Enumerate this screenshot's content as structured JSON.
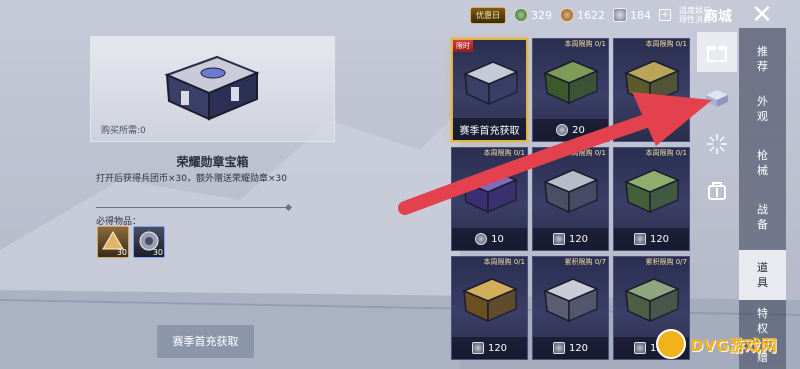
{
  "topbar": {
    "vip_label": "优惠日",
    "currencies": [
      {
        "icon": "green-coin-icon",
        "value": "329"
      },
      {
        "icon": "bronze-coin-icon",
        "value": "1622"
      },
      {
        "icon": "token-icon",
        "value": "184"
      }
    ],
    "notice": "适度娱乐 理性消费",
    "title": "商城",
    "close": "✕"
  },
  "detail": {
    "requirement": "购买所需:0",
    "name": "荣耀勋章宝箱",
    "description": "打开后获得兵团币×30，额外赠送荣耀勋章×30",
    "must_label": "必得物品：",
    "must_items": [
      {
        "icon": "medal-icon",
        "count": "30"
      },
      {
        "icon": "corps-coin-icon",
        "count": "30"
      }
    ],
    "action": "赛季首充获取"
  },
  "grid": [
    {
      "tag": "限时",
      "limit": "",
      "price": "赛季首充获取",
      "price_type": "text",
      "selected": true,
      "art": "silver"
    },
    {
      "tag": "",
      "limit": "本周限购 0/1",
      "price": "20",
      "price_type": "coin",
      "selected": false,
      "art": "green"
    },
    {
      "tag": "",
      "limit": "本周限购 0/1",
      "price": "",
      "price_type": "none",
      "selected": false,
      "art": "olive"
    },
    {
      "tag": "",
      "limit": "本周限购 0/1",
      "price": "10",
      "price_type": "coin",
      "selected": false,
      "art": "purple"
    },
    {
      "tag": "",
      "limit": "本周限购 0/1",
      "price": "120",
      "price_type": "square",
      "selected": false,
      "art": "silverchest"
    },
    {
      "tag": "",
      "limit": "本周限购 0/1",
      "price": "120",
      "price_type": "square",
      "selected": false,
      "art": "greenchest"
    },
    {
      "tag": "",
      "limit": "本周限购 0/1",
      "price": "120",
      "price_type": "square",
      "selected": false,
      "art": "goldchest"
    },
    {
      "tag": "",
      "limit": "累积限购 0/7",
      "price": "120",
      "price_type": "square",
      "selected": false,
      "art": "silverbox"
    },
    {
      "tag": "",
      "limit": "累积限购 0/7",
      "price": "120",
      "price_type": "square",
      "selected": false,
      "art": "greenbox"
    }
  ],
  "categories": [
    {
      "icon": "gift-icon",
      "active": true
    },
    {
      "icon": "box-icon",
      "active": false
    },
    {
      "icon": "firework-icon",
      "active": false
    },
    {
      "icon": "bag-icon",
      "active": false
    }
  ],
  "nav": [
    {
      "label": "推\n荐",
      "active": false
    },
    {
      "label": "外\n观",
      "active": false
    },
    {
      "label": "枪\n械",
      "active": false
    },
    {
      "label": "战\n备",
      "active": false
    },
    {
      "label": "道\n具",
      "active": true
    },
    {
      "label": "特\n权",
      "active": false
    },
    {
      "label": "赠",
      "active": false
    }
  ],
  "watermark": "DVG游戏网",
  "colors": {
    "accent": "#e0b545",
    "arrow": "#e3414d",
    "watermark": "#f2b21b"
  }
}
